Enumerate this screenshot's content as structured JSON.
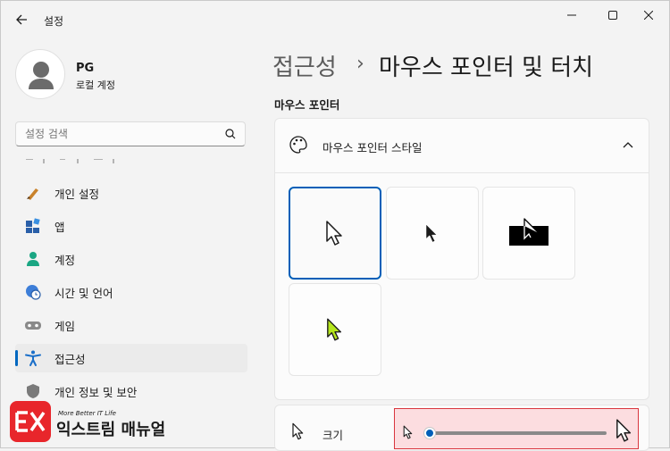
{
  "window": {
    "title": "설정",
    "back_icon": "back-arrow-icon",
    "controls": [
      "minimize-icon",
      "maximize-icon",
      "close-icon"
    ]
  },
  "profile": {
    "name": "PG",
    "account_type": "로컬 계정"
  },
  "search": {
    "placeholder": "설정 검색"
  },
  "nav": {
    "items": [
      {
        "label": "개인 설정",
        "icon": "brush-icon"
      },
      {
        "label": "앱",
        "icon": "apps-icon"
      },
      {
        "label": "계정",
        "icon": "account-icon"
      },
      {
        "label": "시간 및 언어",
        "icon": "time-language-icon"
      },
      {
        "label": "게임",
        "icon": "gamepad-icon"
      },
      {
        "label": "접근성",
        "icon": "accessibility-icon",
        "active": true
      },
      {
        "label": "개인 정보 및 보안",
        "icon": "shield-icon"
      }
    ]
  },
  "breadcrumb": {
    "parent": "접근성",
    "separator": "›",
    "current": "마우스 포인터 및 터치"
  },
  "section": {
    "title": "마우스 포인터"
  },
  "pointer_style": {
    "title": "마우스 포인터 스타일",
    "options": [
      {
        "name": "white",
        "selected": true
      },
      {
        "name": "black",
        "selected": false
      },
      {
        "name": "inverted",
        "selected": false
      },
      {
        "name": "custom",
        "selected": false,
        "color": "#b5e61d"
      }
    ]
  },
  "size": {
    "label": "크기",
    "value_fraction": 0.0
  },
  "watermark": {
    "tagline": "More Better IT Life",
    "name": "익스트림 매뉴얼"
  },
  "colors": {
    "accent": "#005fb8",
    "highlight_border": "#d9363e",
    "highlight_fill": "#fcdde0",
    "brand_red": "#e8262b"
  }
}
